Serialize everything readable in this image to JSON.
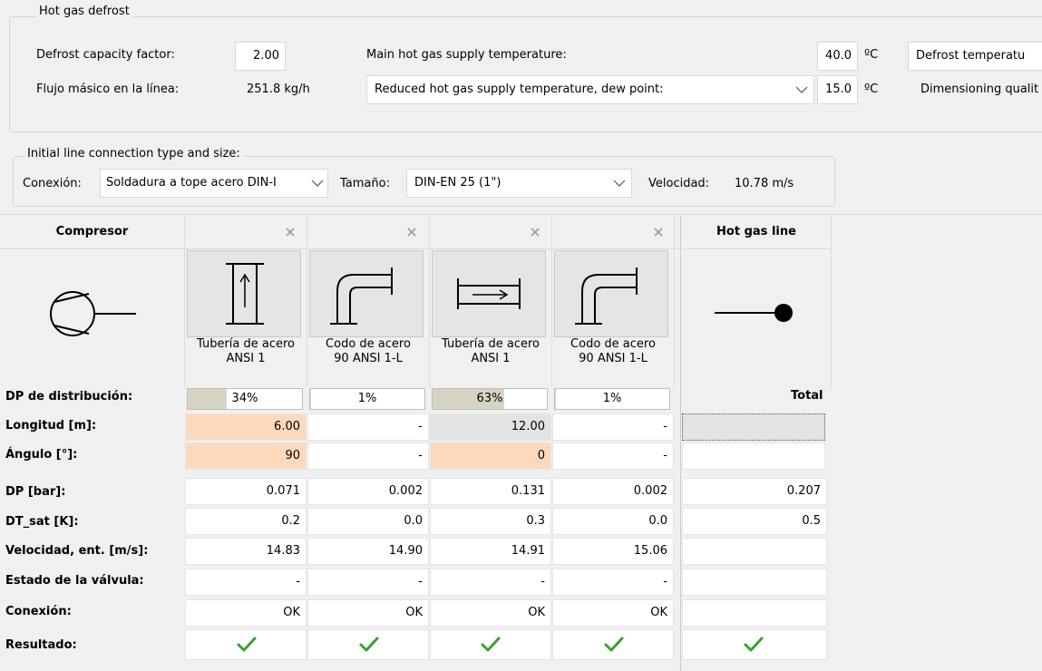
{
  "hot_gas_defrost": {
    "title": "Hot gas defrost",
    "defrost_capacity_label": "Defrost capacity factor:",
    "defrost_capacity_value": "2.00",
    "flujo_label": "Flujo másico en la línea:",
    "flujo_value": "251.8 kg/h",
    "main_supply_label": "Main hot gas supply temperature:",
    "main_supply_value": "40.0",
    "main_supply_unit": "ºC",
    "reduced_supply_select": "Reduced hot gas supply temperature, dew point:",
    "reduced_supply_value": "15.0",
    "reduced_supply_unit": "ºC",
    "defrost_temp_label": "Defrost temperatu",
    "dimensioning_label": "Dimensioning qualit"
  },
  "initial_line": {
    "title": "Initial line connection type and size:",
    "conexion_label": "Conexión:",
    "conexion_value": "Soldadura a tope acero DIN-I",
    "tamano_label": "Tamaño:",
    "tamano_value": "DIN-EN 25 (1\")",
    "velocidad_label": "Velocidad:",
    "velocidad_value": "10.78 m/s"
  },
  "table": {
    "compressor_header": "Compresor",
    "hot_gas_header": "Hot gas line",
    "components": [
      {
        "name_line1": "Tubería de acero",
        "name_line2": "ANSI 1",
        "icon": "vertical-pipe-icon",
        "pct": "34%",
        "pct_fill": 0.34
      },
      {
        "name_line1": "Codo de acero",
        "name_line2": "90 ANSI 1-L",
        "icon": "elbow-icon",
        "pct": "1%",
        "pct_fill": 0.01
      },
      {
        "name_line1": "Tubería de acero",
        "name_line2": "ANSI 1",
        "icon": "horizontal-pipe-icon",
        "pct": "63%",
        "pct_fill": 0.63
      },
      {
        "name_line1": "Codo de acero",
        "name_line2": "90 ANSI 1-L",
        "icon": "elbow-icon",
        "pct": "1%",
        "pct_fill": 0.01
      }
    ],
    "total_label": "Total",
    "rows": [
      {
        "label": "DP de distribución:"
      },
      {
        "label": "Longitud [m]:",
        "values": [
          "6.00",
          "-",
          "12.00",
          "-"
        ],
        "total": ""
      },
      {
        "label": "Ángulo [°]:",
        "values": [
          "90",
          "-",
          "0",
          "-"
        ],
        "total": ""
      },
      {
        "label": "DP [bar]:",
        "values": [
          "0.071",
          "0.002",
          "0.131",
          "0.002"
        ],
        "total": "0.207"
      },
      {
        "label": "DT_sat [K]:",
        "values": [
          "0.2",
          "0.0",
          "0.3",
          "0.0"
        ],
        "total": "0.5"
      },
      {
        "label": "Velocidad, ent. [m/s]:",
        "values": [
          "14.83",
          "14.90",
          "14.91",
          "15.06"
        ],
        "total": ""
      },
      {
        "label": "Estado de la válvula:",
        "values": [
          "-",
          "-",
          "-",
          "-"
        ],
        "total": ""
      },
      {
        "label": "Conexión:",
        "values": [
          "OK",
          "OK",
          "OK",
          "OK"
        ],
        "total": ""
      },
      {
        "label": "Resultado:"
      }
    ]
  },
  "colors": {
    "editable_orange": "#fcd9bd",
    "readonly_gray": "#e3e3e3",
    "check_green": "#3aa12f",
    "pct_fill": "#d8d4c4"
  }
}
